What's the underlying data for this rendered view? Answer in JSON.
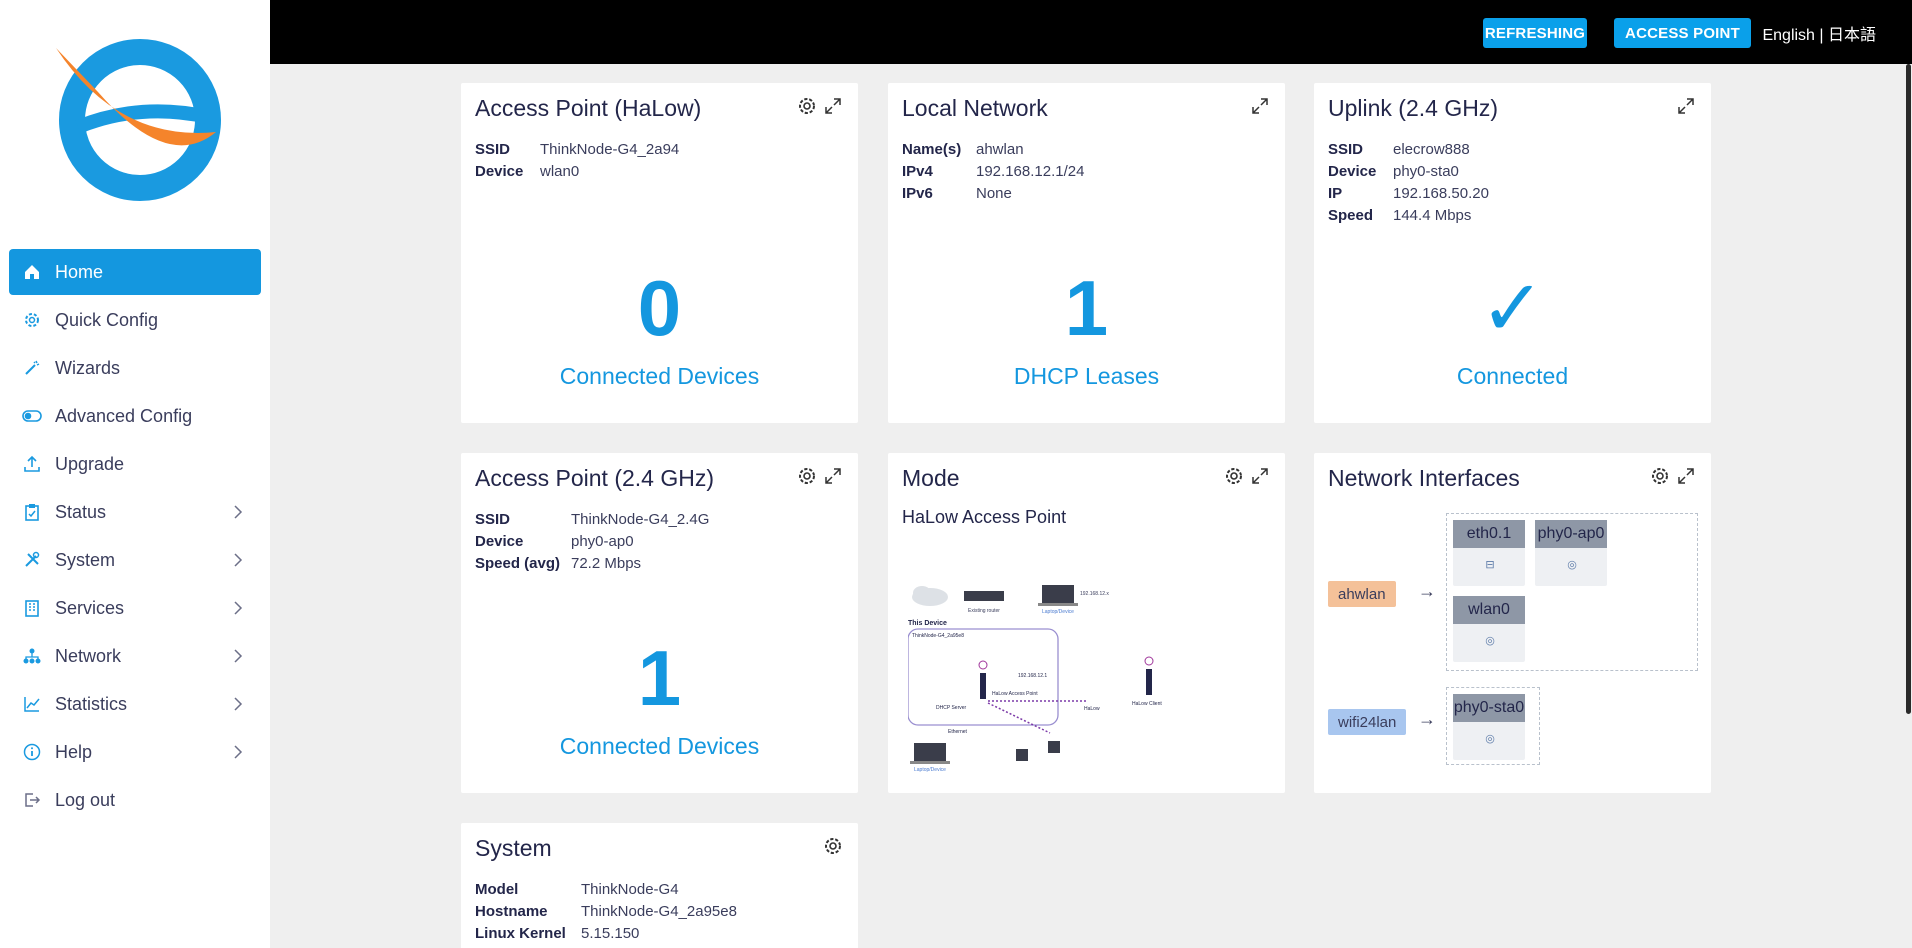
{
  "sidebar": {
    "items": [
      {
        "label": "Home",
        "icon": "home-icon",
        "active": true
      },
      {
        "label": "Quick Config",
        "icon": "gear-icon"
      },
      {
        "label": "Wizards",
        "icon": "magic-wand-icon"
      },
      {
        "label": "Advanced Config",
        "icon": "toggle-icon"
      },
      {
        "label": "Upgrade",
        "icon": "upload-icon"
      },
      {
        "label": "Status",
        "icon": "clipboard-icon",
        "submenu": true
      },
      {
        "label": "System",
        "icon": "tools-icon",
        "submenu": true
      },
      {
        "label": "Services",
        "icon": "building-icon",
        "submenu": true
      },
      {
        "label": "Network",
        "icon": "network-icon",
        "submenu": true
      },
      {
        "label": "Statistics",
        "icon": "chart-line-icon",
        "submenu": true
      },
      {
        "label": "Help",
        "icon": "info-icon",
        "submenu": true
      },
      {
        "label": "Log out",
        "icon": "logout-icon"
      }
    ]
  },
  "topbar": {
    "refreshing": "REFRESHING",
    "access_point": "ACCESS POINT",
    "language": "English | 日本語"
  },
  "colors": {
    "accent": "#1497df",
    "topbar": "#000000",
    "logo_blue": "#1a9ae0",
    "logo_orange": "#f5842b"
  },
  "cards": {
    "ap_halow": {
      "title": "Access Point (HaLow)",
      "rows": [
        {
          "k": "SSID",
          "v": "ThinkNode-G4_2a94"
        },
        {
          "k": "Device",
          "v": "wlan0"
        }
      ],
      "big": "0",
      "label": "Connected Devices"
    },
    "local_network": {
      "title": "Local Network",
      "rows": [
        {
          "k": "Name(s)",
          "v": "ahwlan"
        },
        {
          "k": "IPv4",
          "v": "192.168.12.1/24"
        },
        {
          "k": "IPv6",
          "v": "None"
        }
      ],
      "big": "1",
      "label": "DHCP Leases"
    },
    "uplink": {
      "title": "Uplink (2.4 GHz)",
      "rows": [
        {
          "k": "SSID",
          "v": "elecrow888"
        },
        {
          "k": "Device",
          "v": "phy0-sta0"
        },
        {
          "k": "IP",
          "v": "192.168.50.20"
        },
        {
          "k": "Speed",
          "v": "144.4 Mbps"
        }
      ],
      "big": "✓",
      "label": "Connected"
    },
    "ap_24": {
      "title": "Access Point (2.4 GHz)",
      "rows": [
        {
          "k": "SSID",
          "v": "ThinkNode-G4_2.4G"
        },
        {
          "k": "Device",
          "v": "phy0-ap0"
        },
        {
          "k": "Speed (avg)",
          "v": "72.2 Mbps"
        }
      ],
      "big": "1",
      "label": "Connected Devices"
    },
    "mode": {
      "title": "Mode",
      "subtitle": "HaLow Access Point",
      "diagram": {
        "this_device": "This Device",
        "device_name": "ThinkNode-G4_2a95e8",
        "existing_router": "Existing router",
        "laptop_device": "Laptop/Device",
        "halow_client": "HaLow Client",
        "halow_ap": "HaLow Access Point",
        "dhcp_server": "DHCP Server",
        "ethernet": "Ethernet",
        "halow": "HaLow",
        "ip_1": "192.168.12.1",
        "ip_x": "192.168.12.x"
      }
    },
    "network_interfaces": {
      "title": "Network Interfaces",
      "groups": [
        {
          "name": "ahwlan",
          "color": "#f4c199",
          "ifaces": [
            "eth0.1",
            "phy0-ap0",
            "wlan0"
          ]
        },
        {
          "name": "wifi24lan",
          "color": "#a8c6ef",
          "ifaces": [
            "phy0-sta0"
          ]
        }
      ],
      "arrow": "→"
    },
    "system": {
      "title": "System",
      "rows": [
        {
          "k": "Model",
          "v": "ThinkNode-G4"
        },
        {
          "k": "Hostname",
          "v": "ThinkNode-G4_2a95e8"
        },
        {
          "k": "Linux Kernel",
          "v": "5.15.150"
        }
      ]
    }
  }
}
